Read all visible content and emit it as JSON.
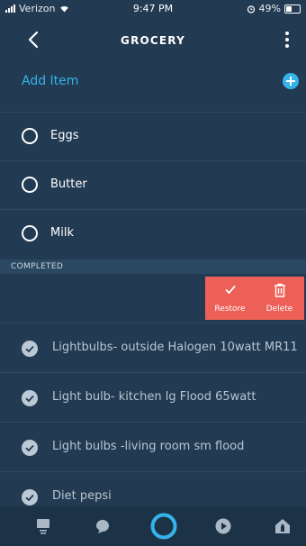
{
  "status": {
    "carrier": "Verizon",
    "time": "9:47 PM",
    "battery": "49%",
    "battery_level": 0.49
  },
  "header": {
    "title": "GROCERY"
  },
  "add_item": {
    "label": "Add Item"
  },
  "items": [
    {
      "label": "Eggs"
    },
    {
      "label": "Butter"
    },
    {
      "label": "Milk"
    }
  ],
  "completed": {
    "header": "COMPLETED",
    "actions": {
      "restore": "Restore",
      "delete": "Delete"
    },
    "items": [
      {
        "label": "Lightbulbs- outside Halogen 10watt MR11"
      },
      {
        "label": "Light bulb- kitchen  lg Flood 65watt"
      },
      {
        "label": "Light bulbs  -living room sm flood"
      },
      {
        "label": "Diet pepsi"
      }
    ]
  },
  "nav": {
    "icons": [
      "home-icon",
      "chat-icon",
      "alexa-icon",
      "play-icon",
      "devices-icon"
    ]
  },
  "colors": {
    "background": "#223a52",
    "accent": "#35b4ea",
    "swipe": "#ec6057",
    "nav_bg": "#1c3247"
  }
}
